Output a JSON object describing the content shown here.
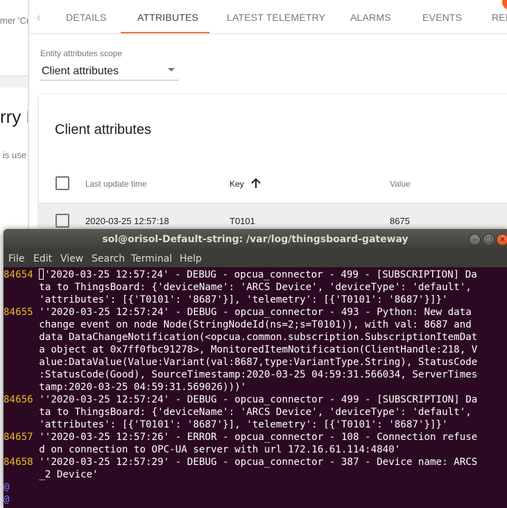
{
  "background_app": {
    "left_fragments": {
      "customer": "mer 'Cu",
      "title": "rry F",
      "used": "is  use"
    },
    "tabs": [
      {
        "label": "DETAILS"
      },
      {
        "label": "ATTRIBUTES"
      },
      {
        "label": "LATEST TELEMETRY"
      },
      {
        "label": "ALARMS"
      },
      {
        "label": "EVENTS"
      },
      {
        "label": "REL"
      }
    ],
    "active_tab": "ATTRIBUTES",
    "scope": {
      "label": "Entity attributes scope",
      "value": "Client attributes"
    },
    "card": {
      "title": "Client attributes",
      "columns": {
        "time": "Last update time",
        "key": "Key",
        "value": "Value"
      },
      "rows": [
        {
          "time": "2020-03-25 12:57:18",
          "key": "T0101",
          "value": "8675"
        }
      ]
    },
    "colors": {
      "tab_ink": "#ff7043",
      "badge": "#ff5722"
    }
  },
  "terminal": {
    "title": "sol@orisol-Default-string: /var/log/thingsboard-gateway",
    "menu": [
      "File",
      "Edit",
      "View",
      "Search",
      "Terminal",
      "Help"
    ],
    "lines": [
      {
        "num": "84654",
        "text": "'2020-03-25 12:57:24' - DEBUG - opcua_connector - 499 - [SUBSCRIPTION] Da"
      },
      {
        "num": "",
        "text": "ta to ThingsBoard: {'deviceName': 'ARCS Device', 'deviceType': 'default',"
      },
      {
        "num": "",
        "text": "'attributes': [{'T0101': '8687'}], 'telemetry': [{'T0101': '8687'}]}'"
      },
      {
        "num": "84655",
        "text": "''2020-03-25 12:57:24' - DEBUG - opcua_connector - 493 - Python: New data"
      },
      {
        "num": "",
        "text": "change event on node Node(StringNodeId(ns=2;s=T0101)), with val: 8687 and"
      },
      {
        "num": "",
        "text": "data DataChangeNotification(<opcua.common.subscription.SubscriptionItemDat"
      },
      {
        "num": "",
        "text": "a object at 0x7ff0fbc91278>, MonitoredItemNotification(ClientHandle:218, V"
      },
      {
        "num": "",
        "text": "alue:DataValue(Value:Variant(val:8687,type:VariantType.String), StatusCode"
      },
      {
        "num": "",
        "text": ":StatusCode(Good), SourceTimestamp:2020-03-25 04:59:31.566034, ServerTimes"
      },
      {
        "num": "",
        "text": "tamp:2020-03-25 04:59:31.569026)))'"
      },
      {
        "num": "84656",
        "text": "''2020-03-25 12:57:24' - DEBUG - opcua_connector - 499 - [SUBSCRIPTION] Da"
      },
      {
        "num": "",
        "text": "ta to ThingsBoard: {'deviceName': 'ARCS Device', 'deviceType': 'default',"
      },
      {
        "num": "",
        "text": "'attributes': [{'T0101': '8687'}], 'telemetry': [{'T0101': '8687'}]}'"
      },
      {
        "num": "84657",
        "text": "''2020-03-25 12:57:26' - ERROR - opcua_connector - 108 - Connection refuse"
      },
      {
        "num": "",
        "text": "d on connection to OPC-UA server with url 172.16.61.114:4840'"
      },
      {
        "num": "84658",
        "text": "''2020-03-25 12:57:29' - DEBUG - opcua_connector - 387 - Device name: ARCS"
      },
      {
        "num": "",
        "text": "_2 Device'"
      }
    ],
    "tildes": [
      "@",
      "@"
    ],
    "colors": {
      "background": "#2c0922",
      "line_number": "#e7bc20",
      "text": "#ffffff",
      "close_button": "#e2512c"
    }
  }
}
